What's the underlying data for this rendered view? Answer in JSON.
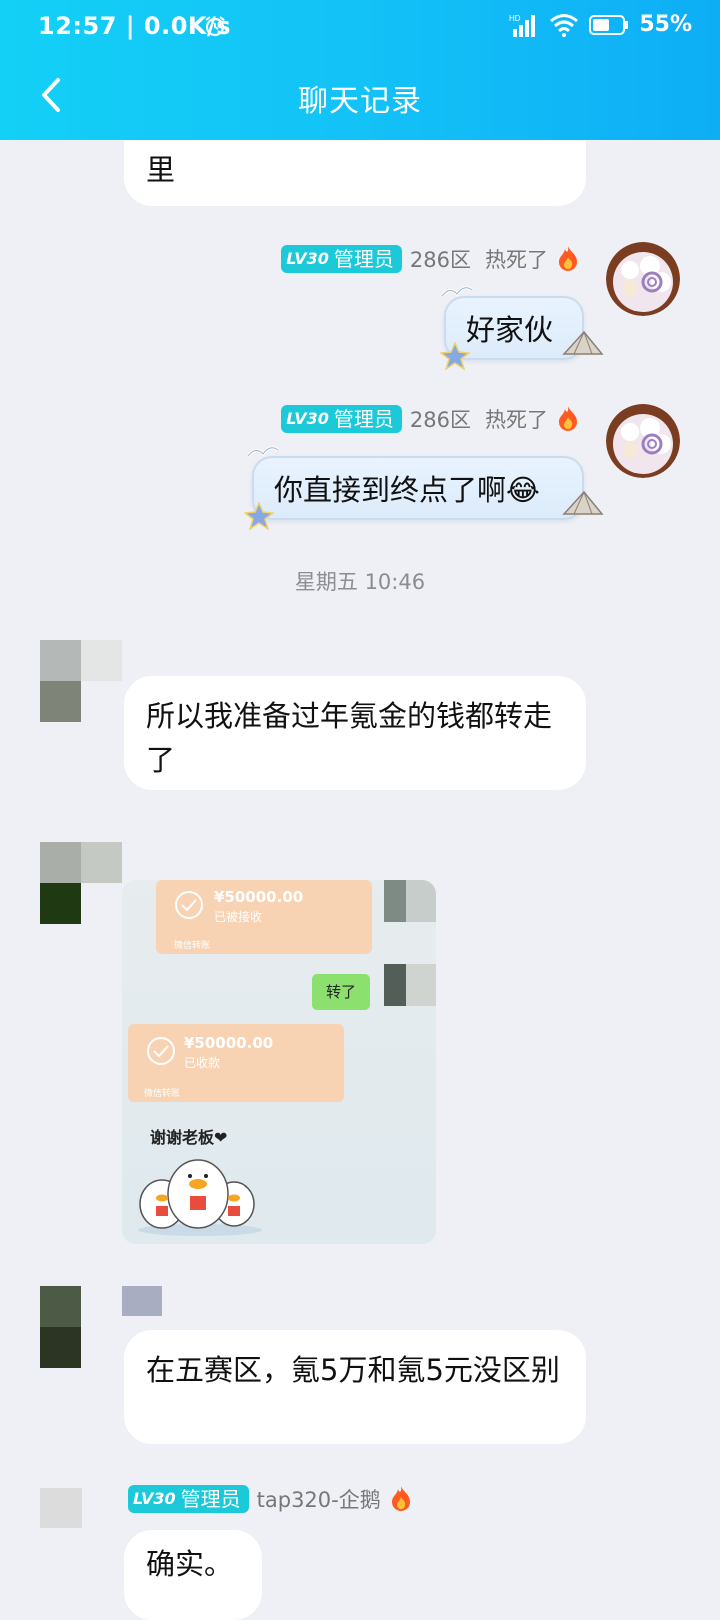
{
  "status_bar": {
    "time_speed": "12:57 | 0.0K/s",
    "network": "HD",
    "battery": "55%"
  },
  "nav": {
    "title": "聊天记录"
  },
  "messages": {
    "m0_text": "里",
    "m1": {
      "level": "LV30",
      "role": "管理员",
      "server": "286区",
      "nickname": "热死了",
      "text": "好家伙"
    },
    "m2": {
      "level": "LV30",
      "role": "管理员",
      "server": "286区",
      "nickname": "热死了",
      "text": "你直接到终点了啊😂"
    },
    "timestamp": "星期五 10:46",
    "m3_text": "所以我准备过年氪金的钱都转走了",
    "m4_image": {
      "card1_amount": "¥50000.00",
      "card1_status": "已被接收",
      "card1_footer": "微信转账",
      "reply": "转了",
      "card2_amount": "¥50000.00",
      "card2_status": "已收款",
      "card2_footer": "微信转账",
      "sticker_text": "谢谢老板❤"
    },
    "m5_text": "在五赛区，氪5万和氪5元没区别",
    "m6": {
      "level": "LV30",
      "role": "管理员",
      "server": "tap320-企鹅",
      "text": "确实。"
    }
  },
  "colors": {
    "header": "#13c2f7",
    "badge": "#1cc9d9",
    "background": "#eef0f5"
  },
  "icons": [
    "alarm-icon",
    "signal-icon",
    "wifi-icon",
    "battery-icon",
    "back-icon",
    "fire-icon",
    "check-icon"
  ]
}
